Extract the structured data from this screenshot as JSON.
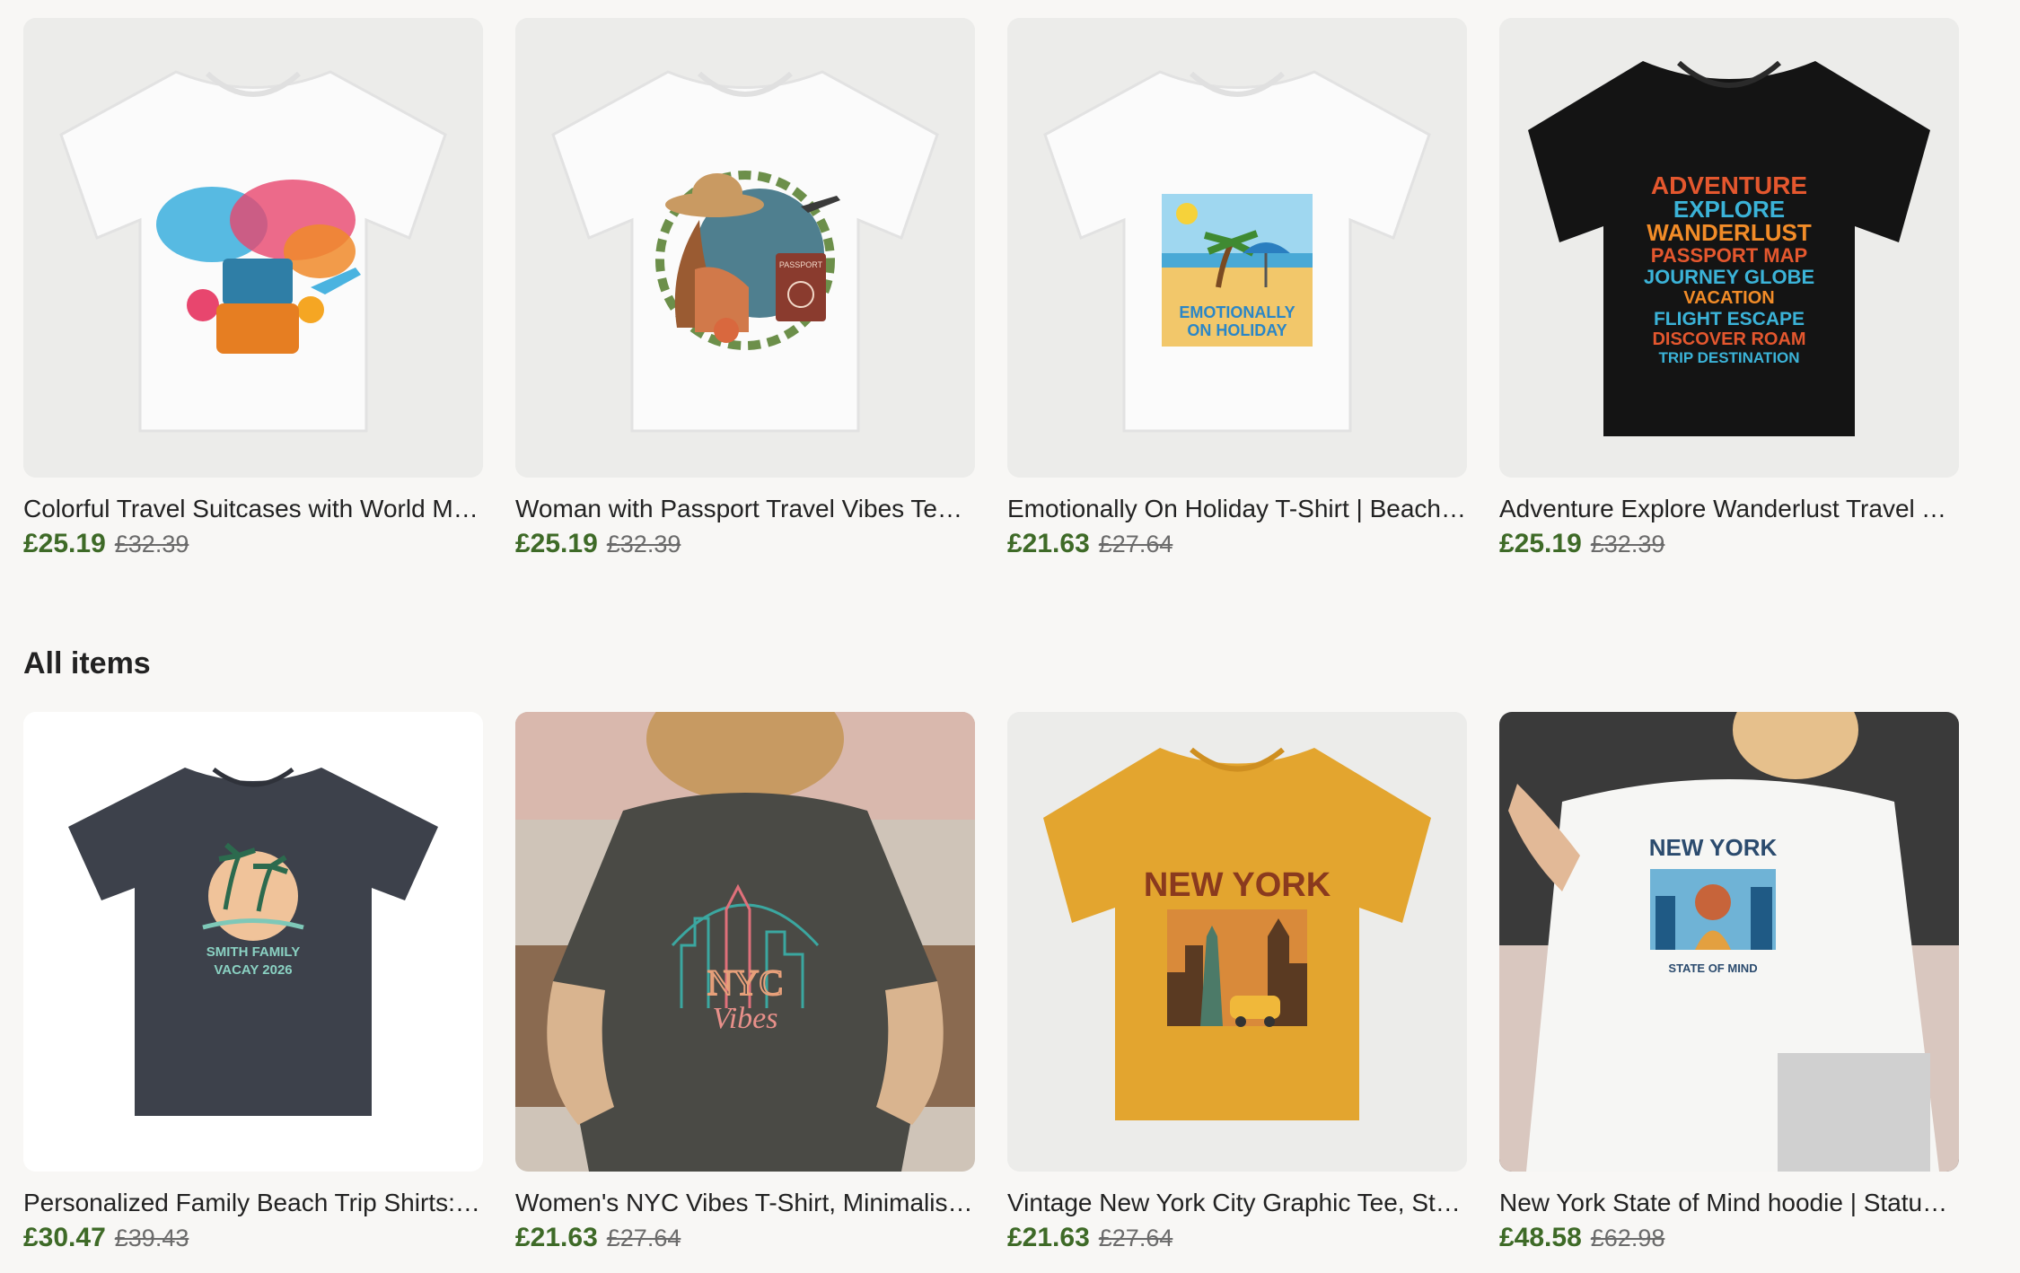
{
  "featured": [
    {
      "title": "Colorful Travel Suitcases with World Ma...",
      "price": "£25.19",
      "old_price": "£32.39"
    },
    {
      "title": "Woman with Passport Travel Vibes Tee | ...",
      "price": "£25.19",
      "old_price": "£32.39"
    },
    {
      "title": "Emotionally On Holiday T-Shirt | Beach P...",
      "price": "£21.63",
      "old_price": "£27.64"
    },
    {
      "title": "Adventure Explore Wanderlust Travel Te...",
      "price": "£25.19",
      "old_price": "£32.39"
    }
  ],
  "section_title": "All items",
  "all_items": [
    {
      "title": "Personalized Family Beach Trip Shirts: M...",
      "price": "£30.47",
      "old_price": "£39.43"
    },
    {
      "title": "Women's NYC Vibes T-Shirt, Minimalist ...",
      "price": "£21.63",
      "old_price": "£27.64"
    },
    {
      "title": "Vintage New York City Graphic Tee, Stat...",
      "price": "£21.63",
      "old_price": "£27.64"
    },
    {
      "title": "New York State of Mind hoodie | Statue ...",
      "price": "£48.58",
      "old_price": "£62.98"
    }
  ],
  "shirt_graphics": {
    "emotionally": [
      "EMOTIONALLY",
      "ON HOLIDAY"
    ],
    "adventure": [
      "ADVENTURE",
      "EXPLORE",
      "WANDERLUST",
      "PASSPORT MAP",
      "JOURNEY GLOBE",
      "VACATION",
      "FLIGHT ESCAPE",
      "DISCOVER ROAM",
      "TRIP DESTINATION"
    ],
    "passport": "PASSPORT",
    "smith": [
      "SMITH FAMILY",
      "VACAY 2026"
    ],
    "nyc": [
      "NYC",
      "Vibes"
    ],
    "newyork_vintage": "NEW YORK",
    "newyork_state": [
      "NEW YORK",
      "STATE OF MIND"
    ]
  },
  "colors": {
    "price_green": "#3e6a27",
    "background": "#f8f7f5"
  }
}
